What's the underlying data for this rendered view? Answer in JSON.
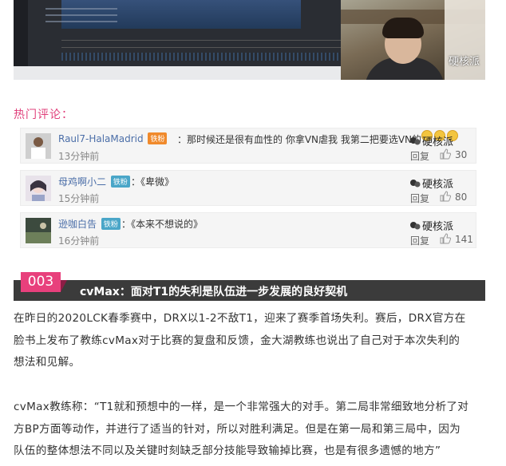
{
  "video_screenshot": {
    "watermark": "硬核派"
  },
  "hot_comments": {
    "title": "热门评论：",
    "reply_label": "回复",
    "watermark": "硬核派",
    "items": [
      {
        "user": "Raul7-HalaMadrid",
        "badge": "铁粉",
        "text": "：那时候还是很有血性的 你拿VN虐我 我第二把要选VN的",
        "time": "13分钟前",
        "likes": "30"
      },
      {
        "user": "母鸡啊小二",
        "badge": "铁粉",
        "text": "：《卑微》",
        "time": "15分钟前",
        "likes": "80"
      },
      {
        "user": "逊咖白告",
        "badge": "铁粉",
        "text": "：《本来不想说的》",
        "time": "16分钟前",
        "likes": "141"
      }
    ]
  },
  "section": {
    "number": "003",
    "title": "cvMax：面对T1的失利是队伍进一步发展的良好契机"
  },
  "article": {
    "para1_lines": [
      "在昨日的2020LCK春季赛中，DRX以1-2不敌T1，迎来了赛季首场失利。赛后，DRX官方在",
      "脸书上发布了教练cvMax对于比赛的复盘和反馈，金大湖教练也说出了自己对于本次失利的",
      "想法和见解。"
    ],
    "para2_lines": [
      "cvMax教练称：“T1就和预想中的一样，是一个非常强大的对手。第二局非常细致地分析了对",
      "方BP方面等动作，并进行了适当的针对，所以对胜利满足。但是在第一局和第三局中，因为",
      "队伍的整体想法不同以及关键时刻缺乏部分技能导致输掉比赛，也是有很多遗憾的地方”"
    ]
  },
  "colors": {
    "accent_pink": "#e8407c",
    "username_blue": "#4b6ea8",
    "badge_orange": "#f08a2c",
    "badge_teal": "#4aa6c8",
    "section_bar": "#3b3b3b"
  }
}
